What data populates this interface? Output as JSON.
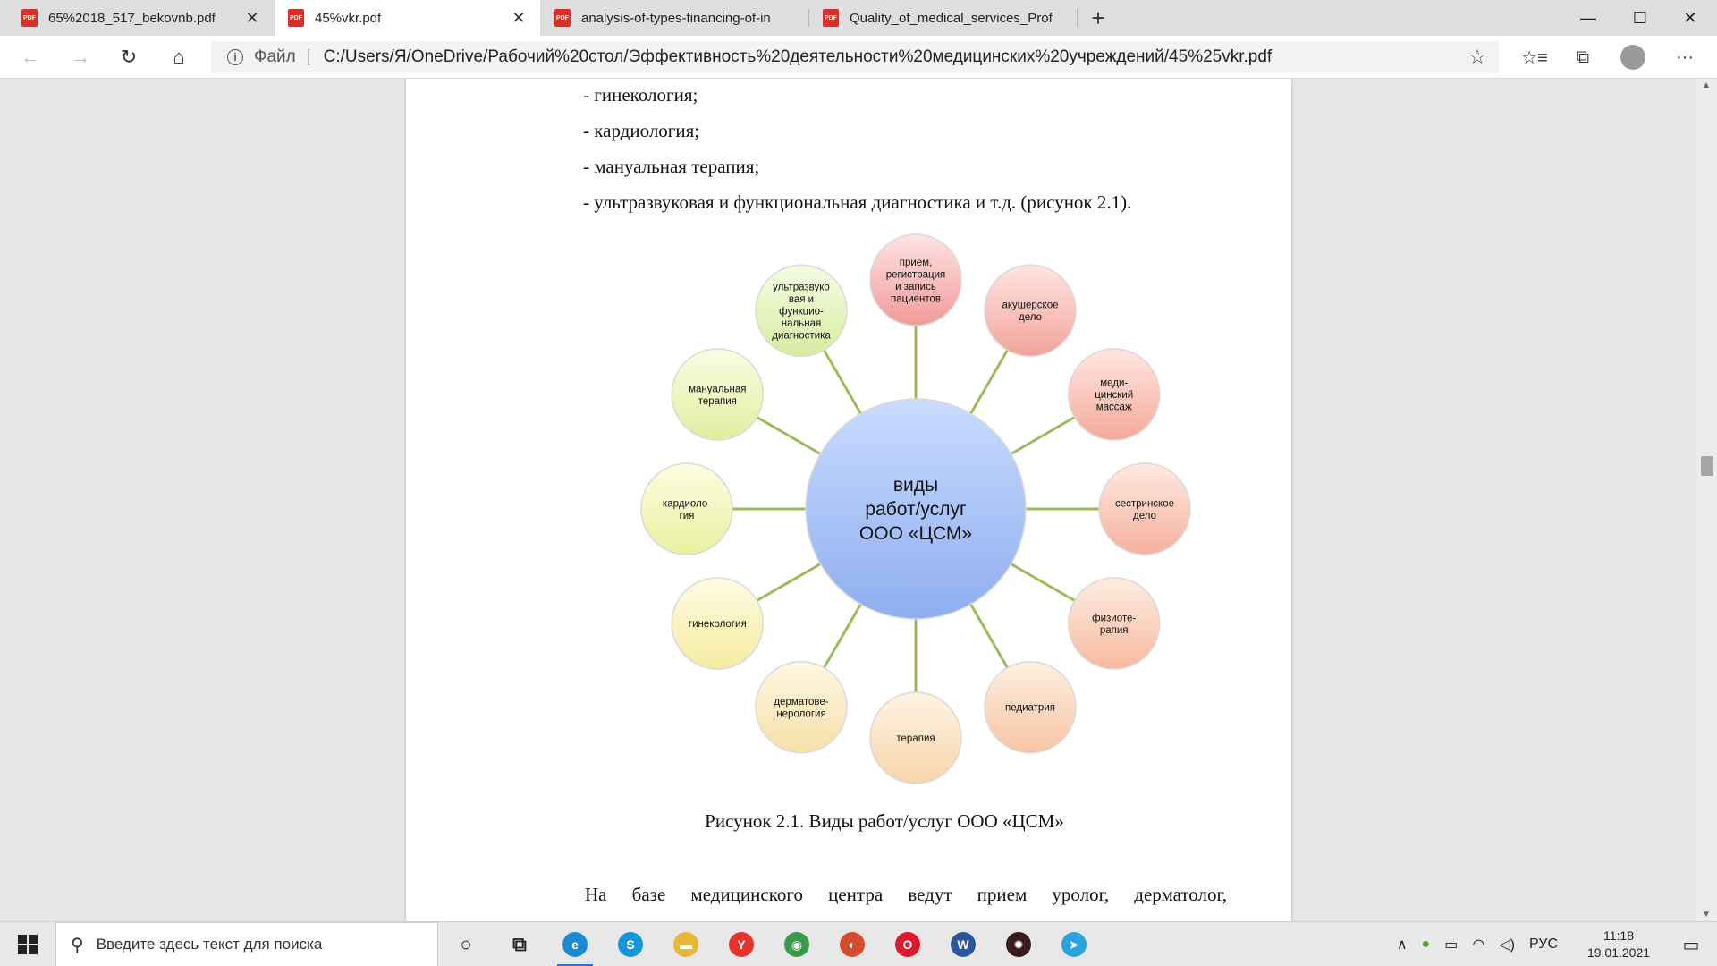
{
  "tabs": [
    {
      "title": "65%2018_517_bekovnb.pdf",
      "active": false
    },
    {
      "title": "45%vkr.pdf",
      "active": true
    },
    {
      "title": "analysis-of-types-financing-of-in",
      "active": false
    },
    {
      "title": "Quality_of_medical_services_Prof",
      "active": false
    }
  ],
  "pdf_icon_label": "PDF",
  "close_glyph": "✕",
  "new_tab_glyph": "+",
  "window": {
    "minimize": "—",
    "maximize": "☐",
    "close": "✕"
  },
  "nav": {
    "back": "←",
    "forward": "→",
    "refresh": "↻",
    "home": "⌂"
  },
  "address": {
    "info_glyph": "i",
    "scheme_label": "Файл",
    "divider": "|",
    "url": "C:/Users/Я/OneDrive/Рабочий%20стол/Эффективность%20деятельности%20медицинских%20учреждений/45%25vkr.pdf",
    "star": "☆"
  },
  "toolbar_icons": {
    "favorites": "☆≡",
    "collections": "⧉",
    "more": "···"
  },
  "page": {
    "bullets": [
      "- гинекология;",
      "- кардиология;",
      "- мануальная терапия;",
      "- ультразвуковая и функциональная диагностика и т.д. (рисунок 2.1)."
    ],
    "caption": "Рисунок 2.1. Виды работ/услуг ООО «ЦСМ»",
    "paragraph": "На базе медицинского центра ведут прием уролог, дерматолог,"
  },
  "diagram": {
    "center": {
      "lines": [
        "виды",
        "работ/услуг",
        "ООО «ЦСМ»"
      ],
      "color_top": "#c9dcff",
      "color_bottom": "#8eaef0"
    },
    "connector_color": "#9bbb59",
    "nodes": [
      {
        "lines": [
          "прием,",
          "регистрация",
          "и запись",
          "пациентов"
        ],
        "c1": "#ffe3e3",
        "c2": "#f29a9a"
      },
      {
        "lines": [
          "акушерское",
          "дело"
        ],
        "c1": "#ffe4e1",
        "c2": "#f4a39c"
      },
      {
        "lines": [
          "меди-",
          "цинский",
          "массаж"
        ],
        "c1": "#ffe6e0",
        "c2": "#f4aa9b"
      },
      {
        "lines": [
          "сестринское",
          "дело"
        ],
        "c1": "#ffe9e0",
        "c2": "#f5b29e"
      },
      {
        "lines": [
          "физиоте-",
          "рапия"
        ],
        "c1": "#ffece0",
        "c2": "#f6ba9f"
      },
      {
        "lines": [
          "педиатрия"
        ],
        "c1": "#ffefe0",
        "c2": "#f7c4a4"
      },
      {
        "lines": [
          "терапия"
        ],
        "c1": "#fff3e2",
        "c2": "#f8d4ab"
      },
      {
        "lines": [
          "дерматове-",
          "нерология"
        ],
        "c1": "#fff7e2",
        "c2": "#f7e0a8"
      },
      {
        "lines": [
          "гинекология"
        ],
        "c1": "#fffbe2",
        "c2": "#f4ec9e"
      },
      {
        "lines": [
          "кардиоло-",
          "гия"
        ],
        "c1": "#fdfde2",
        "c2": "#eaf0a0"
      },
      {
        "lines": [
          "мануальная",
          "терапия"
        ],
        "c1": "#f9fde2",
        "c2": "#dfeea0"
      },
      {
        "lines": [
          "ультразвуко",
          "вая и",
          "функцио-",
          "нальная",
          "диагностика"
        ],
        "c1": "#f4fde2",
        "c2": "#d6eca0"
      }
    ]
  },
  "taskbar": {
    "search_placeholder": "Введите здесь текст для поиска",
    "search_glyph": "⚲",
    "apps": [
      {
        "name": "cortana-icon",
        "glyph": "○",
        "color": "transparent"
      },
      {
        "name": "task-view-icon",
        "glyph": "⧉",
        "color": "transparent"
      },
      {
        "name": "edge-icon",
        "glyph": "e",
        "color": "#1a8ad4"
      },
      {
        "name": "skype-icon",
        "glyph": "S",
        "color": "#1296d8"
      },
      {
        "name": "file-explorer-icon",
        "glyph": "▬",
        "color": "#e8b73a"
      },
      {
        "name": "yandex-browser-icon",
        "glyph": "Y",
        "color": "#e8322d"
      },
      {
        "name": "chrome-icon",
        "glyph": "◉",
        "color": "#3b9a4a"
      },
      {
        "name": "app-red-icon",
        "glyph": "◐",
        "color": "#d44c2c"
      },
      {
        "name": "opera-icon",
        "glyph": "O",
        "color": "#e0182d"
      },
      {
        "name": "word-icon",
        "glyph": "W",
        "color": "#2b579a"
      },
      {
        "name": "app-dark-icon",
        "glyph": "✹",
        "color": "#3a1a1a"
      },
      {
        "name": "telegram-icon",
        "glyph": "➤",
        "color": "#2ca3dd"
      }
    ],
    "tray": {
      "up": "∧",
      "lang": "РУС"
    },
    "time": "11:18",
    "date": "19.01.2021"
  }
}
